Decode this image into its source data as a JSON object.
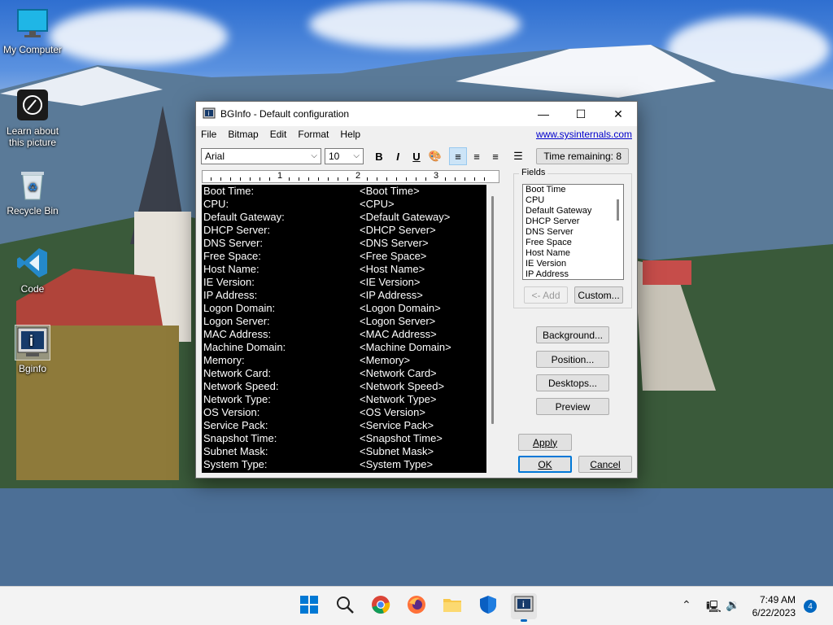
{
  "desktop": {
    "icons": [
      {
        "label": "My Computer",
        "name": "my-computer"
      },
      {
        "label": "Learn about this picture",
        "name": "learn-about-picture"
      },
      {
        "label": "Recycle Bin",
        "name": "recycle-bin"
      },
      {
        "label": "Code",
        "name": "vscode"
      },
      {
        "label": "Bginfo",
        "name": "bginfo"
      }
    ]
  },
  "window": {
    "title": "BGInfo - Default configuration",
    "menu": [
      "File",
      "Bitmap",
      "Edit",
      "Format",
      "Help"
    ],
    "link": "www.sysinternals.com",
    "font_name": "Arial",
    "font_size": "10",
    "time_remaining": "Time remaining: 8",
    "ruler_numbers": [
      "1",
      "2",
      "3"
    ],
    "fields_label": "Fields",
    "fields": [
      "Boot Time",
      "CPU",
      "Default Gateway",
      "DHCP Server",
      "DNS Server",
      "Free Space",
      "Host Name",
      "IE Version",
      "IP Address"
    ],
    "rows": [
      {
        "label": "Boot Time:",
        "value": "<Boot Time>"
      },
      {
        "label": "CPU:",
        "value": "<CPU>"
      },
      {
        "label": "Default Gateway:",
        "value": "<Default Gateway>"
      },
      {
        "label": "DHCP Server:",
        "value": "<DHCP Server>"
      },
      {
        "label": "DNS Server:",
        "value": "<DNS Server>"
      },
      {
        "label": "Free Space:",
        "value": "<Free Space>"
      },
      {
        "label": "Host Name:",
        "value": "<Host Name>"
      },
      {
        "label": "IE Version:",
        "value": "<IE Version>"
      },
      {
        "label": "IP Address:",
        "value": "<IP Address>"
      },
      {
        "label": "Logon Domain:",
        "value": "<Logon Domain>"
      },
      {
        "label": "Logon Server:",
        "value": "<Logon Server>"
      },
      {
        "label": "MAC Address:",
        "value": "<MAC Address>"
      },
      {
        "label": "Machine Domain:",
        "value": "<Machine Domain>"
      },
      {
        "label": "Memory:",
        "value": "<Memory>"
      },
      {
        "label": "Network Card:",
        "value": "<Network Card>"
      },
      {
        "label": "Network Speed:",
        "value": "<Network Speed>"
      },
      {
        "label": "Network Type:",
        "value": "<Network Type>"
      },
      {
        "label": "OS Version:",
        "value": "<OS Version>"
      },
      {
        "label": "Service Pack:",
        "value": "<Service Pack>"
      },
      {
        "label": "Snapshot Time:",
        "value": "<Snapshot Time>"
      },
      {
        "label": "Subnet Mask:",
        "value": "<Subnet Mask>"
      },
      {
        "label": "System Type:",
        "value": "<System Type>"
      }
    ],
    "buttons": {
      "add": "<- Add",
      "custom": "Custom...",
      "background": "Background...",
      "position": "Position...",
      "desktops": "Desktops...",
      "preview": "Preview",
      "apply": "Apply",
      "ok": "OK",
      "cancel": "Cancel"
    }
  },
  "taskbar": {
    "time": "7:49 AM",
    "date": "6/22/2023",
    "notifications": "4",
    "apps": [
      "start-icon",
      "search-icon",
      "chrome-icon",
      "firefox-icon",
      "file-explorer-icon",
      "defender-icon",
      "bginfo-icon"
    ]
  },
  "colors": {
    "accent": "#0067c0",
    "link": "#0000cc",
    "editor_bg": "#000000"
  }
}
